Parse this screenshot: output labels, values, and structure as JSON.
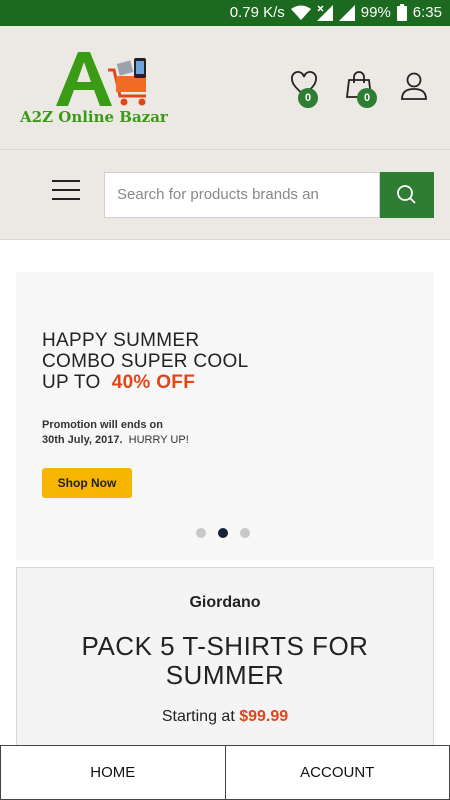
{
  "status_bar": {
    "speed": "0.79 K/s",
    "battery": "99%",
    "time": "6:35"
  },
  "header": {
    "logo_text": "A2Z Online Bazar",
    "wishlist_count": "0",
    "cart_count": "0",
    "icons": [
      "heart-icon",
      "shopping-bag-icon",
      "user-icon"
    ]
  },
  "search": {
    "placeholder": "Search for products brands an",
    "menu_icon": "hamburger-menu-icon",
    "button_icon": "search-icon"
  },
  "hero": {
    "line1": "HAPPY SUMMER",
    "line2": "COMBO SUPER COOL",
    "line3_prefix": "UP TO",
    "line3_highlight": "40% OFF",
    "promo_line1": "Promotion will ends on",
    "promo_date": "30th July, 2017.",
    "promo_hurry": "HURRY UP!",
    "cta": "Shop Now",
    "slide_count": 3,
    "active_slide": 2
  },
  "product": {
    "brand": "Giordano",
    "title_line1": "PACK 5 T-SHIRTS FOR",
    "title_line2": "SUMMER",
    "price_prefix": "Starting at",
    "price": "$99.99"
  },
  "tabs": {
    "home": "HOME",
    "account": "ACCOUNT"
  },
  "colors": {
    "status_bar": "#1b6a1f",
    "brand_green": "#2e7d32",
    "accent_orange": "#e0461a",
    "cta_yellow": "#f7b500"
  }
}
